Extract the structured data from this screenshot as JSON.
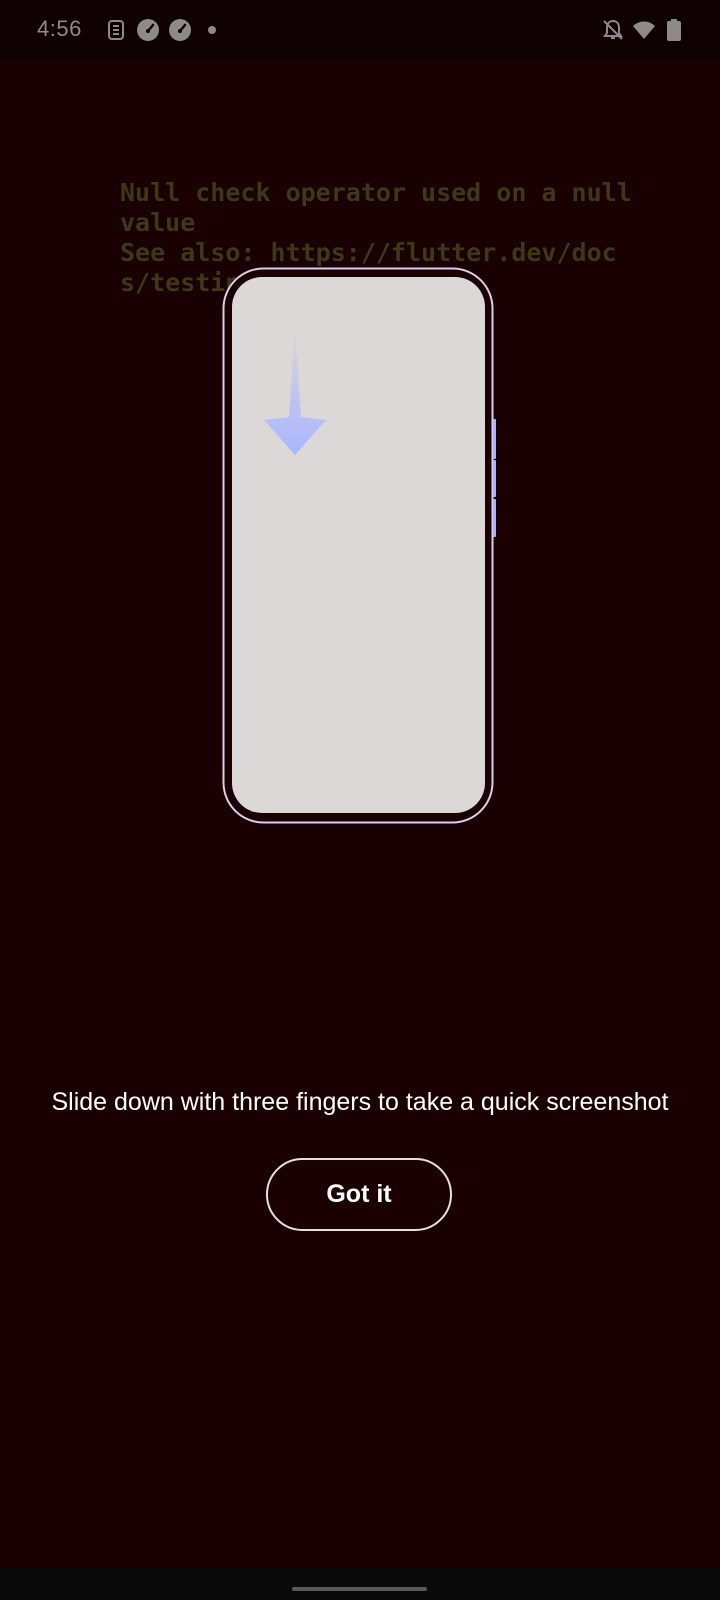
{
  "status_bar": {
    "time": "4:56",
    "left_icons": [
      "sim-toolkit-icon",
      "speedometer-icon",
      "speedometer-icon",
      "notification-dot-icon"
    ],
    "right_icons": [
      "notifications-off-icon",
      "wifi-icon",
      "battery-icon"
    ]
  },
  "background_app": {
    "error_message": "Null check operator used on a null value\nSee also: https://flutter.dev/docs/testing/errors"
  },
  "tutorial": {
    "illustration": "phone-three-finger-swipe-down",
    "instruction": "Slide down with three fingers to take a quick screenshot",
    "button_label": "Got it"
  },
  "colors": {
    "background": "#1a0003",
    "error_text": "#3d3816",
    "phone_screen": "#dcd8d8",
    "phone_frame": "#d9cfe8",
    "arrow": "#a9b6ff",
    "button_border": "#e6dfe0"
  }
}
